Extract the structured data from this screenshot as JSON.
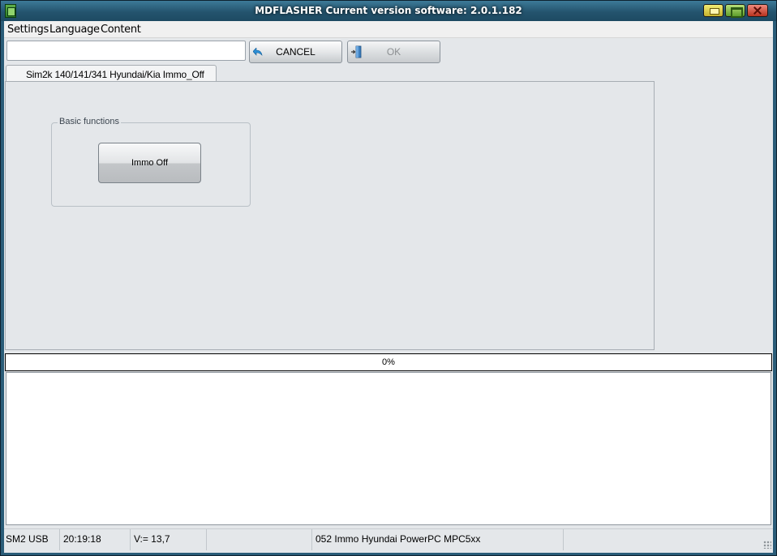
{
  "window": {
    "title": "MDFLASHER  Current version software: 2.0.1.182"
  },
  "menu": {
    "items": [
      "Settings",
      "Language",
      "Content"
    ]
  },
  "toolbar": {
    "input_value": "",
    "cancel_label": "CANCEL",
    "ok_label": "OK"
  },
  "tabs": [
    {
      "label": "Sim2k 140/141/341   Hyundai/Kia  Immo_Off"
    }
  ],
  "panel": {
    "group_title": "Basic functions",
    "immo_button_label": "Immo Off"
  },
  "progress": {
    "value": 0,
    "label": "0%"
  },
  "log": {
    "lines": []
  },
  "status": {
    "interface": "SM2 USB",
    "time": "20:19:18",
    "voltage": "V:= 13,7",
    "empty_cell": "",
    "module": "052 Immo Hyundai PowerPC MPC5xx",
    "extra": ""
  },
  "colors": {
    "titlebar": "#24546e",
    "client_bg": "#e4e7ea"
  }
}
